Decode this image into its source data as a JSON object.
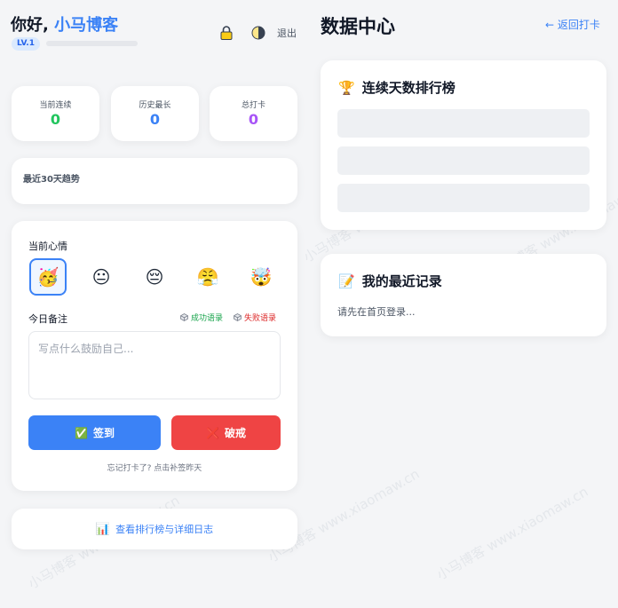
{
  "header": {
    "greeting": "你好, ",
    "brand": "小马博客",
    "level": "LV.1",
    "level_progress": 0,
    "lock_icon": "lock-icon",
    "theme_icon": "half-moon-icon",
    "logout": "退出"
  },
  "stats": [
    {
      "label": "当前连续",
      "value": "0",
      "color": "#22c55e"
    },
    {
      "label": "历史最长",
      "value": "0",
      "color": "#3b82f6"
    },
    {
      "label": "总打卡",
      "value": "0",
      "color": "#a855f7"
    }
  ],
  "trend": {
    "title": "最近30天趋势"
  },
  "mood": {
    "title": "当前心情",
    "emojis": [
      "🥳",
      "😐",
      "😔",
      "😤",
      "🤯"
    ],
    "selected": 0
  },
  "note": {
    "title": "今日备注",
    "success_quote": "成功语录",
    "fail_quote": "失败语录",
    "placeholder": "写点什么鼓励自己..."
  },
  "actions": {
    "checkin_icon": "✅",
    "checkin": "签到",
    "break_icon": "❌",
    "break": "破戒",
    "forgot": "忘记打卡了? 点击补签昨天"
  },
  "view_more": {
    "icon": "📊",
    "label": "查看排行榜与详细日志"
  },
  "right": {
    "title": "数据中心",
    "back": "← 返回打卡",
    "rank_icon": "🏆",
    "rank_title": "连续天数排行榜",
    "records_icon": "📝",
    "records_title": "我的最近记录",
    "records_hint": "请先在首页登录..."
  },
  "watermark": {
    "text": "小马博客 www.xiaomaw.cn"
  },
  "colors": {
    "accent": "#3b82f6",
    "danger": "#ef4444",
    "success": "#22c55e"
  }
}
